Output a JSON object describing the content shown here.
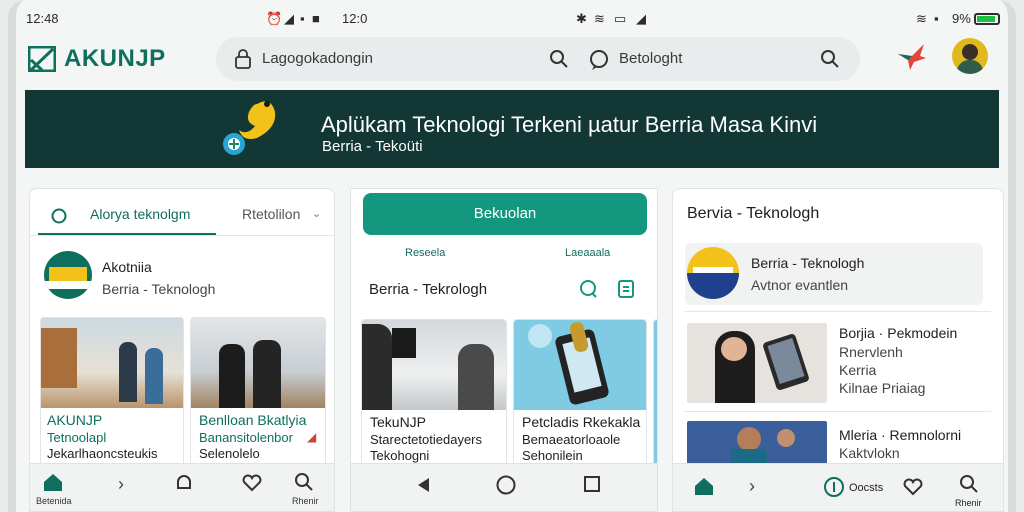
{
  "statusbar": {
    "time": "12:48",
    "center_time": "12:0",
    "battery_text": "9%"
  },
  "app": {
    "logo_text": "AKUNJP"
  },
  "search": {
    "placeholder": "Lagogokadongin",
    "right_label": "Betologht"
  },
  "banner": {
    "title": "Aplükam Teknologi Terkeni µatur Berria Masa Kinvi",
    "subtitle": "Berria - Tekoüti"
  },
  "panel_left": {
    "tab_active": "Alorya teknolgm",
    "tab_other": "Rtetolilon",
    "profile_name": "Akotniia",
    "profile_sub": "Berria - Teknologh",
    "cards": [
      {
        "title": "AKUNJP",
        "line1": "Tetnoolapl",
        "line2": "Jekarlhaoncsteukis"
      },
      {
        "title": "Benlloan Bkatlyia",
        "line1": "Banansitolenbor",
        "line2": "Selenolelo"
      }
    ],
    "nav": {
      "home": "Betenida",
      "search": "Rhenir"
    }
  },
  "panel_center": {
    "button_label": "Bekuolan",
    "link_left": "Reseela",
    "link_right": "Laeaaala",
    "section_title": "Berria - Tekrologh",
    "cards": [
      {
        "title": "TekuNJP",
        "line1": "Starectetotiedayers",
        "line2": "Tekohogni"
      },
      {
        "title": "Petcladis Rkekakla",
        "line1": "Bemaeatorloaole",
        "line2": "Sehonilein"
      }
    ]
  },
  "panel_right": {
    "section_title": "Bervia - Teknologh",
    "featured_title": "Berria - Teknologh",
    "featured_sub": "Avtnor evantlen",
    "list": [
      {
        "title": "Borjia · Pekmodein",
        "line1": "Rnervlenh",
        "line2": "Kerria",
        "line3": "Kilnae Priaiag"
      },
      {
        "title": "Mleria · Remnolorni",
        "line1": "Kaktvlokn",
        "line2": "",
        "line3": ""
      }
    ],
    "nav": {
      "center_label": "Oocsts",
      "search": "Rhenir"
    }
  },
  "colors": {
    "brand": "#0f6f5e",
    "banner_bg": "#123735",
    "button_bg": "#14977f"
  }
}
